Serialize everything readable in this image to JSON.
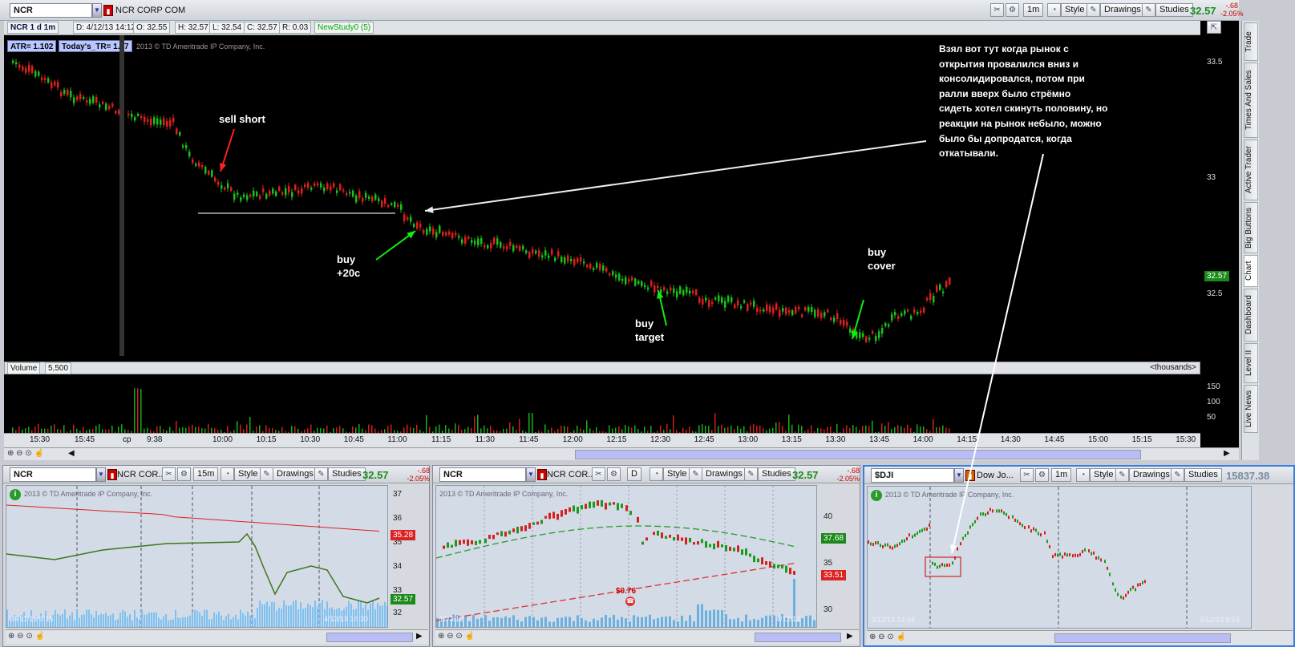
{
  "top": {
    "symbol": "NCR",
    "company": "NCR CORP COM",
    "timeframe_btn": "1m",
    "style_btn": "Style",
    "drawings_btn": "Drawings",
    "studies_btn": "Studies",
    "last_price": "32.57",
    "change": "-.68",
    "change_pct": "-2.05%"
  },
  "info_bar": {
    "title": "NCR 1 d 1m",
    "date": "D: 4/12/13 14:12",
    "open": "O: 32.55",
    "high": "H: 32.57",
    "low": "L: 32.54",
    "close": "C: 32.57",
    "range": "R: 0.03",
    "study": "NewStudy0 (5)"
  },
  "legend": {
    "atr": "ATR= 1.102",
    "today_tr": "Today's_TR= 1.07"
  },
  "copyright": "2013 © TD Ameritrade IP Company, Inc.",
  "price_axis": [
    "33.5",
    "33",
    "32.5"
  ],
  "price_tag": "32.57",
  "annotations": {
    "sell_short": "sell short",
    "buy_20c": "buy\n+20c",
    "buy_target": "buy\ntarget",
    "buy_cover": "buy\ncover",
    "comment": "Взял вот тут когда рынок с\nоткрытия провалился вниз и\nконсолидировался, потом при\nралли вверх было стрёмно\nсидеть хотел скинуть половину, но\nреакции на рынок небыло, можно\nбыло бы допродатся, когда\nоткатывали."
  },
  "volume": {
    "label": "Volume",
    "value": "5,500",
    "units": "<thousands>",
    "axis": [
      "150",
      "100",
      "50"
    ]
  },
  "time_axis": [
    "15:30",
    "15:45",
    "cp",
    "9:38",
    "10:00",
    "10:15",
    "10:30",
    "10:45",
    "11:00",
    "11:15",
    "11:30",
    "11:45",
    "12:00",
    "12:15",
    "12:30",
    "12:45",
    "13:00",
    "13:15",
    "13:30",
    "13:45",
    "14:00",
    "14:15",
    "14:30",
    "14:45",
    "15:00",
    "15:15",
    "15:30"
  ],
  "side_tabs": [
    "Trade",
    "Times And Sales",
    "Active Trader",
    "Big Buttons",
    "Chart",
    "Dashboard",
    "Level II",
    "Live News"
  ],
  "panes": [
    {
      "symbol": "NCR",
      "company": "NCR COR...",
      "tf": "15m",
      "style": "Style",
      "drawings": "Drawings",
      "studies": "Studies",
      "price": "32.57",
      "change": "-.68",
      "change_pct": "-2.05%",
      "copyright": "2013 © TD Ameritrade IP Company, Inc.",
      "axis": [
        "37",
        "36",
        "35",
        "34",
        "33",
        "32"
      ],
      "tag_red": "35.28",
      "tag_green": "32.57",
      "date_left": "26/11/13 9:15",
      "date_right": "4/12/13 16:30"
    },
    {
      "symbol": "NCR",
      "company": "NCR COR...",
      "tf": "D",
      "style": "Style",
      "drawings": "Drawings",
      "studies": "Studies",
      "price": "32.57",
      "change": "-.68",
      "change_pct": "-2.05%",
      "copyright": "2013 © TD Ameritrade IP Company, Inc.",
      "axis": [
        "40",
        "35",
        "30"
      ],
      "tag_green": "37.68",
      "tag_red": "33.51",
      "dividend": "$0.76",
      "date_left": "10/3/12",
      "date_right": "4/12/13"
    },
    {
      "symbol": "$DJI",
      "company": "Dow Jo...",
      "tf": "1m",
      "style": "Style",
      "drawings": "Drawings",
      "studies": "Studies",
      "price": "15837.38",
      "copyright": "2013 © TD Ameritrade IP Company, Inc.",
      "date_left": "3/12/13 14:44",
      "date_right": "5/12/13 9:54"
    }
  ]
}
